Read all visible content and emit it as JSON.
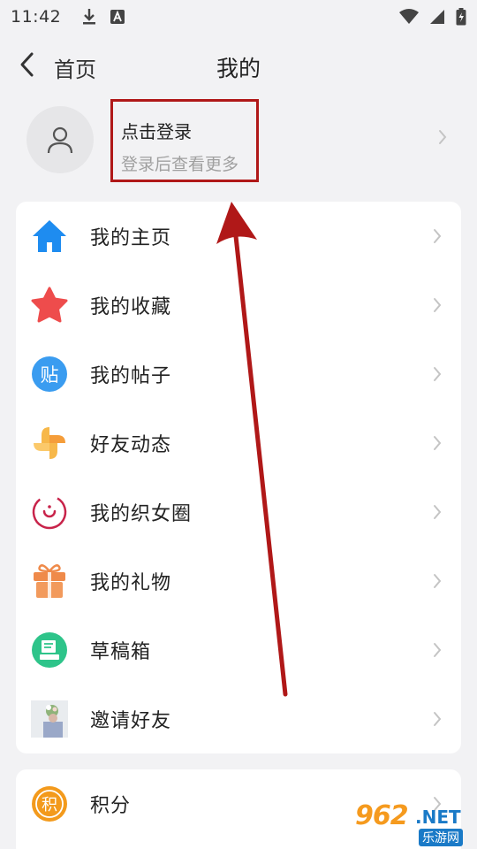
{
  "status_bar": {
    "time": "11:42",
    "icons": [
      "download-icon",
      "a-notification-icon",
      "wifi-icon",
      "signal-icon",
      "battery-charging-icon"
    ]
  },
  "nav": {
    "back_label": "首页",
    "title": "我的"
  },
  "profile": {
    "login_title": "点击登录",
    "login_subtitle": "登录后查看更多"
  },
  "menu": [
    {
      "label": "我的主页",
      "icon": "home-icon"
    },
    {
      "label": "我的收藏",
      "icon": "star-icon"
    },
    {
      "label": "我的帖子",
      "icon": "post-icon",
      "icon_text": "贴"
    },
    {
      "label": "好友动态",
      "icon": "pinwheel-icon"
    },
    {
      "label": "我的织女圈",
      "icon": "circle-icon"
    },
    {
      "label": "我的礼物",
      "icon": "gift-icon"
    },
    {
      "label": "草稿箱",
      "icon": "drafts-icon"
    },
    {
      "label": "邀请好友",
      "icon": "invite-photo-icon"
    }
  ],
  "points": {
    "label": "积分",
    "icon": "points-icon",
    "icon_text": "积"
  },
  "watermark": {
    "number": "962",
    "domain": ".NET",
    "site": "乐游网"
  },
  "colors": {
    "annotation_red": "#b01818",
    "home_blue": "#1e8cf0",
    "star_red": "#ee4c4c",
    "post_blue": "#3a9cf0",
    "points_orange": "#f39a1c",
    "drafts_green": "#2ec48a"
  }
}
